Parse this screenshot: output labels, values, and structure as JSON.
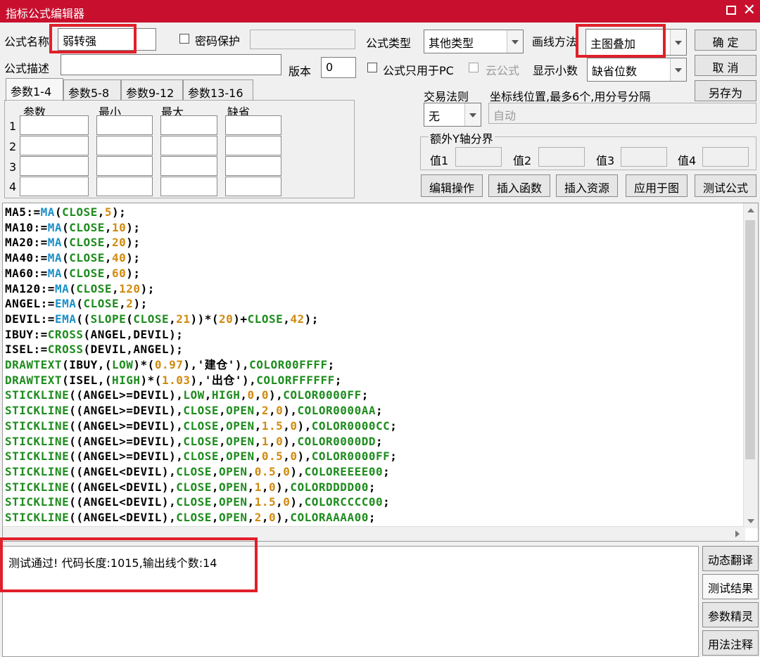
{
  "window": {
    "title": "指标公式编辑器"
  },
  "form": {
    "name_label": "公式名称",
    "name_value": "弱转强",
    "password_label": "密码保护",
    "type_label": "公式类型",
    "type_value": "其他类型",
    "draw_label": "画线方法",
    "draw_value": "主图叠加",
    "desc_label": "公式描述",
    "version_label": "版本",
    "version_value": "0",
    "pc_only_label": "公式只用于PC",
    "cloud_label": "云公式",
    "decimal_label": "显示小数",
    "decimal_value": "缺省位数",
    "trade_label": "交易法则",
    "trade_value": "无",
    "coord_label": "坐标线位置,最多6个,用分号分隔",
    "coord_value": "自动",
    "yaxis_group_label": "额外Y轴分界",
    "y_values": [
      "值1",
      "值2",
      "值3",
      "值4"
    ]
  },
  "buttons": {
    "ok": "确 定",
    "cancel": "取 消",
    "save_as": "另存为",
    "edit_ops": "编辑操作",
    "insert_func": "插入函数",
    "insert_res": "插入资源",
    "apply_chart": "应用于图",
    "test_formula": "测试公式",
    "dyn_translate": "动态翻译",
    "test_result": "测试结果",
    "param_wizard": "参数精灵",
    "usage_notes": "用法注释"
  },
  "tabs": [
    "参数1-4",
    "参数5-8",
    "参数9-12",
    "参数13-16"
  ],
  "param_headers": [
    "参数",
    "最小",
    "最大",
    "缺省"
  ],
  "param_rows": [
    "1",
    "2",
    "3",
    "4"
  ],
  "code": [
    [
      [
        "MA5:=",
        "k"
      ],
      [
        "MA",
        "f"
      ],
      [
        "(",
        "k"
      ],
      [
        "CLOSE",
        "g"
      ],
      [
        ",",
        "k"
      ],
      [
        "5",
        "n"
      ],
      [
        ");",
        "k"
      ]
    ],
    [
      [
        "MA10:=",
        "k"
      ],
      [
        "MA",
        "f"
      ],
      [
        "(",
        "k"
      ],
      [
        "CLOSE",
        "g"
      ],
      [
        ",",
        "k"
      ],
      [
        "10",
        "n"
      ],
      [
        ");",
        "k"
      ]
    ],
    [
      [
        "MA20:=",
        "k"
      ],
      [
        "MA",
        "f"
      ],
      [
        "(",
        "k"
      ],
      [
        "CLOSE",
        "g"
      ],
      [
        ",",
        "k"
      ],
      [
        "20",
        "n"
      ],
      [
        ");",
        "k"
      ]
    ],
    [
      [
        "MA40:=",
        "k"
      ],
      [
        "MA",
        "f"
      ],
      [
        "(",
        "k"
      ],
      [
        "CLOSE",
        "g"
      ],
      [
        ",",
        "k"
      ],
      [
        "40",
        "n"
      ],
      [
        ");",
        "k"
      ]
    ],
    [
      [
        "MA60:=",
        "k"
      ],
      [
        "MA",
        "f"
      ],
      [
        "(",
        "k"
      ],
      [
        "CLOSE",
        "g"
      ],
      [
        ",",
        "k"
      ],
      [
        "60",
        "n"
      ],
      [
        ");",
        "k"
      ]
    ],
    [
      [
        "MA120:=",
        "k"
      ],
      [
        "MA",
        "f"
      ],
      [
        "(",
        "k"
      ],
      [
        "CLOSE",
        "g"
      ],
      [
        ",",
        "k"
      ],
      [
        "120",
        "n"
      ],
      [
        ");",
        "k"
      ]
    ],
    [
      [
        "ANGEL:=",
        "k"
      ],
      [
        "EMA",
        "f"
      ],
      [
        "(",
        "k"
      ],
      [
        "CLOSE",
        "g"
      ],
      [
        ",",
        "k"
      ],
      [
        "2",
        "n"
      ],
      [
        ");",
        "k"
      ]
    ],
    [
      [
        "DEVIL:=",
        "k"
      ],
      [
        "EMA",
        "f"
      ],
      [
        "((",
        "k"
      ],
      [
        "SLOPE",
        "g"
      ],
      [
        "(",
        "k"
      ],
      [
        "CLOSE",
        "g"
      ],
      [
        ",",
        "k"
      ],
      [
        "21",
        "n"
      ],
      [
        "))*(",
        "k"
      ],
      [
        "20",
        "n"
      ],
      [
        ")+",
        "k"
      ],
      [
        "CLOSE",
        "g"
      ],
      [
        ",",
        "k"
      ],
      [
        "42",
        "n"
      ],
      [
        ");",
        "k"
      ]
    ],
    [
      [
        "IBUY:=",
        "k"
      ],
      [
        "CROSS",
        "g"
      ],
      [
        "(ANGEL,DEVIL);",
        "k"
      ]
    ],
    [
      [
        "ISEL:=",
        "k"
      ],
      [
        "CROSS",
        "g"
      ],
      [
        "(DEVIL,ANGEL);",
        "k"
      ]
    ],
    [
      [
        "DRAWTEXT",
        "g"
      ],
      [
        "(IBUY,(",
        "k"
      ],
      [
        "LOW",
        "g"
      ],
      [
        ")*(",
        "k"
      ],
      [
        "0.97",
        "n"
      ],
      [
        "),'建仓'),",
        "k"
      ],
      [
        "COLOR00FFFF",
        "g"
      ],
      [
        ";",
        "k"
      ]
    ],
    [
      [
        "DRAWTEXT",
        "g"
      ],
      [
        "(ISEL,(",
        "k"
      ],
      [
        "HIGH",
        "g"
      ],
      [
        ")*(",
        "k"
      ],
      [
        "1.03",
        "n"
      ],
      [
        "),'出仓'),",
        "k"
      ],
      [
        "COLORFFFFFF",
        "g"
      ],
      [
        ";",
        "k"
      ]
    ],
    [
      [
        "STICKLINE",
        "g"
      ],
      [
        "((ANGEL>=DEVIL),",
        "k"
      ],
      [
        "LOW",
        "g"
      ],
      [
        ",",
        "k"
      ],
      [
        "HIGH",
        "g"
      ],
      [
        ",",
        "k"
      ],
      [
        "0",
        "n"
      ],
      [
        ",",
        "k"
      ],
      [
        "0",
        "n"
      ],
      [
        "),",
        "k"
      ],
      [
        "COLOR0000FF",
        "g"
      ],
      [
        ";",
        "k"
      ]
    ],
    [
      [
        "STICKLINE",
        "g"
      ],
      [
        "((ANGEL>=DEVIL),",
        "k"
      ],
      [
        "CLOSE",
        "g"
      ],
      [
        ",",
        "k"
      ],
      [
        "OPEN",
        "g"
      ],
      [
        ",",
        "k"
      ],
      [
        "2",
        "n"
      ],
      [
        ",",
        "k"
      ],
      [
        "0",
        "n"
      ],
      [
        "),",
        "k"
      ],
      [
        "COLOR0000AA",
        "g"
      ],
      [
        ";",
        "k"
      ]
    ],
    [
      [
        "STICKLINE",
        "g"
      ],
      [
        "((ANGEL>=DEVIL),",
        "k"
      ],
      [
        "CLOSE",
        "g"
      ],
      [
        ",",
        "k"
      ],
      [
        "OPEN",
        "g"
      ],
      [
        ",",
        "k"
      ],
      [
        "1.5",
        "n"
      ],
      [
        ",",
        "k"
      ],
      [
        "0",
        "n"
      ],
      [
        "),",
        "k"
      ],
      [
        "COLOR0000CC",
        "g"
      ],
      [
        ";",
        "k"
      ]
    ],
    [
      [
        "STICKLINE",
        "g"
      ],
      [
        "((ANGEL>=DEVIL),",
        "k"
      ],
      [
        "CLOSE",
        "g"
      ],
      [
        ",",
        "k"
      ],
      [
        "OPEN",
        "g"
      ],
      [
        ",",
        "k"
      ],
      [
        "1",
        "n"
      ],
      [
        ",",
        "k"
      ],
      [
        "0",
        "n"
      ],
      [
        "),",
        "k"
      ],
      [
        "COLOR0000DD",
        "g"
      ],
      [
        ";",
        "k"
      ]
    ],
    [
      [
        "STICKLINE",
        "g"
      ],
      [
        "((ANGEL>=DEVIL),",
        "k"
      ],
      [
        "CLOSE",
        "g"
      ],
      [
        ",",
        "k"
      ],
      [
        "OPEN",
        "g"
      ],
      [
        ",",
        "k"
      ],
      [
        "0.5",
        "n"
      ],
      [
        ",",
        "k"
      ],
      [
        "0",
        "n"
      ],
      [
        "),",
        "k"
      ],
      [
        "COLOR0000FF",
        "g"
      ],
      [
        ";",
        "k"
      ]
    ],
    [
      [
        "STICKLINE",
        "g"
      ],
      [
        "((ANGEL<DEVIL),",
        "k"
      ],
      [
        "CLOSE",
        "g"
      ],
      [
        ",",
        "k"
      ],
      [
        "OPEN",
        "g"
      ],
      [
        ",",
        "k"
      ],
      [
        "0.5",
        "n"
      ],
      [
        ",",
        "k"
      ],
      [
        "0",
        "n"
      ],
      [
        "),",
        "k"
      ],
      [
        "COLOREEEE00",
        "g"
      ],
      [
        ";",
        "k"
      ]
    ],
    [
      [
        "STICKLINE",
        "g"
      ],
      [
        "((ANGEL<DEVIL),",
        "k"
      ],
      [
        "CLOSE",
        "g"
      ],
      [
        ",",
        "k"
      ],
      [
        "OPEN",
        "g"
      ],
      [
        ",",
        "k"
      ],
      [
        "1",
        "n"
      ],
      [
        ",",
        "k"
      ],
      [
        "0",
        "n"
      ],
      [
        "),",
        "k"
      ],
      [
        "COLORDDDD00",
        "g"
      ],
      [
        ";",
        "k"
      ]
    ],
    [
      [
        "STICKLINE",
        "g"
      ],
      [
        "((ANGEL<DEVIL),",
        "k"
      ],
      [
        "CLOSE",
        "g"
      ],
      [
        ",",
        "k"
      ],
      [
        "OPEN",
        "g"
      ],
      [
        ",",
        "k"
      ],
      [
        "1.5",
        "n"
      ],
      [
        ",",
        "k"
      ],
      [
        "0",
        "n"
      ],
      [
        "),",
        "k"
      ],
      [
        "COLORCCCC00",
        "g"
      ],
      [
        ";",
        "k"
      ]
    ],
    [
      [
        "STICKLINE",
        "g"
      ],
      [
        "((ANGEL<DEVIL),",
        "k"
      ],
      [
        "CLOSE",
        "g"
      ],
      [
        ",",
        "k"
      ],
      [
        "OPEN",
        "g"
      ],
      [
        ",",
        "k"
      ],
      [
        "2",
        "n"
      ],
      [
        ",",
        "k"
      ],
      [
        "0",
        "n"
      ],
      [
        "),",
        "k"
      ],
      [
        "COLORAAAA00",
        "g"
      ],
      [
        ";",
        "k"
      ]
    ]
  ],
  "code_colors": {
    "k": "#000000",
    "f": "#1a8fc8",
    "g": "#1e8c1e",
    "n": "#d08a10"
  },
  "output": {
    "text": "测试通过! 代码长度:1015,输出线个数:14"
  },
  "colors": {
    "titlebar": "#c8102e",
    "highlight": "#e0202a"
  }
}
